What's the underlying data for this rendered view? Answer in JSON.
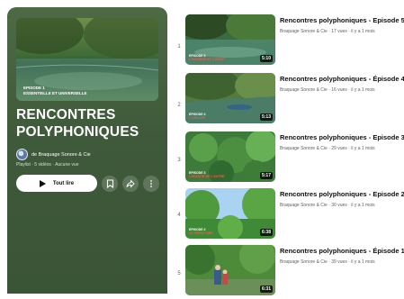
{
  "playlist": {
    "thumb_caption_line1": "Episode 1",
    "thumb_caption_line2": "ESSENTIELLE ET UNIVERSELLE",
    "title": "RENCONTRES POLYPHONIQUES",
    "owner": "de Braquage Sonore & Cie",
    "meta": "Playlist · 5 vidéos · Aucune vue",
    "play_all_label": "Tout lire",
    "icons": [
      "save-icon",
      "share-icon",
      "more-icon"
    ]
  },
  "videos": [
    {
      "index": "1",
      "title": "Rencontres polyphoniques - Episode 5",
      "channel_meta": "Braquage Sonore & Cie · 17 vues · il y a 1 mois",
      "duration": "5:10",
      "label": "EPISODE 5",
      "label_sub": "L'INCONNU ET L'INÉDIT"
    },
    {
      "index": "2",
      "title": "Rencontres polyphoniques - Épisode 4",
      "channel_meta": "Braquage Sonore & Cie · 16 vues · il y a 1 mois",
      "duration": "5:13",
      "label": "EPISODE 4",
      "label_sub": "L'ORALITÉ"
    },
    {
      "index": "3",
      "title": "Rencontres polyphoniques - Episode 3",
      "channel_meta": "Braquage Sonore & Cie · 29 vues · il y a 1 mois",
      "duration": "5:17",
      "label": "EPISODE 3",
      "label_sub": "L'ÉCOUTE DE L'AUTRE"
    },
    {
      "index": "4",
      "title": "Rencontres polyphoniques - Episode 2",
      "channel_meta": "Braquage Sonore & Cie · 30 vues · il y a 1 mois",
      "duration": "6:38",
      "label": "EPISODE 2",
      "label_sub": "LE TERRITOIRE"
    },
    {
      "index": "5",
      "title": "Rencontres polyphoniques - Épisode 1",
      "channel_meta": "Braquage Sonore & Cie · 39 vues · il y a 1 mois",
      "duration": "6:31",
      "label": "",
      "label_sub": ""
    }
  ]
}
